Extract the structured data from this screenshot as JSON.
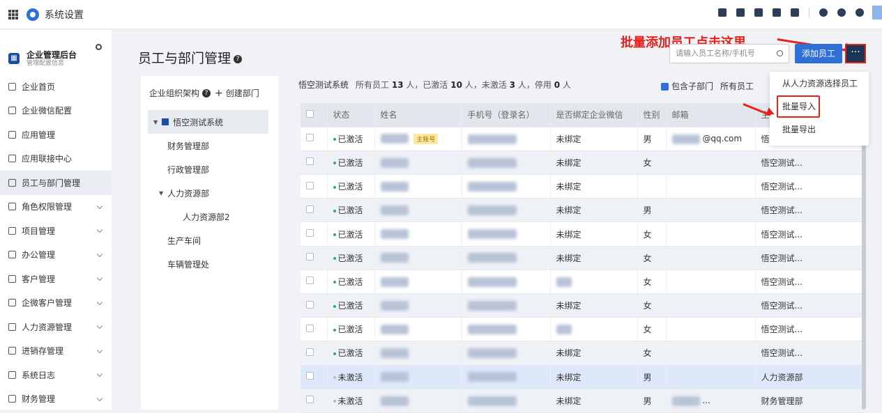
{
  "topbar": {
    "title": "系统设置"
  },
  "sidebar": {
    "header_title": "企业管理后台",
    "header_subtitle": "管理配置信息",
    "items": [
      {
        "label": "企业首页"
      },
      {
        "label": "企业微信配置"
      },
      {
        "label": "应用管理"
      },
      {
        "label": "应用联接中心"
      },
      {
        "label": "员工与部门管理"
      },
      {
        "label": "角色权限管理"
      },
      {
        "label": "项目管理"
      },
      {
        "label": "办公管理"
      },
      {
        "label": "客户管理"
      },
      {
        "label": "企微客户管理"
      },
      {
        "label": "人力资源管理"
      },
      {
        "label": "进销存管理"
      },
      {
        "label": "系统日志"
      },
      {
        "label": "财务管理"
      }
    ]
  },
  "main": {
    "page_title": "员工与部门管理",
    "annotation": "批量添加员工点击这里",
    "search_placeholder": "请输入员工名称/手机号",
    "add_button": "添加员工",
    "more_button": "···",
    "org": {
      "title": "企业组织架构",
      "create": "创建部门",
      "root": "悟空测试系统",
      "depts": [
        "财务管理部",
        "行政管理部",
        "人力资源部",
        "人力资源部2",
        "生产车间",
        "车辆管理处"
      ]
    },
    "list": {
      "company": "悟空测试系统",
      "stats_prefix": "所有员工",
      "total": "13",
      "activated": "10",
      "inactive": "3",
      "disabled": "0",
      "unit": "人",
      "activated_label": "已激活",
      "inactive_label": "未激活",
      "disabled_label": "停用"
    },
    "filter": {
      "include_sub": "包含子部门",
      "all_staff": "所有员工"
    },
    "table": {
      "headers": [
        "状态",
        "姓名",
        "手机号（登录名）",
        "是否绑定企业微信",
        "性别",
        "邮箱",
        "主"
      ],
      "rows": [
        {
          "status": "已激活",
          "wx": "未绑定",
          "gender": "男",
          "email": "@qq.com",
          "dept": "悟"
        },
        {
          "status": "已激活",
          "wx": "未绑定",
          "gender": "女",
          "email": "",
          "dept": "悟空测试..."
        },
        {
          "status": "已激活",
          "wx": "未绑定",
          "gender": "",
          "email": "",
          "dept": "悟空测试..."
        },
        {
          "status": "已激活",
          "wx": "未绑定",
          "gender": "男",
          "email": "",
          "dept": "悟空测试..."
        },
        {
          "status": "已激活",
          "wx": "未绑定",
          "gender": "女",
          "email": "",
          "dept": "悟空测试..."
        },
        {
          "status": "已激活",
          "wx": "未绑定",
          "gender": "女",
          "email": "",
          "dept": "悟空测试..."
        },
        {
          "status": "已激活",
          "wx": "",
          "gender": "女",
          "email": "",
          "dept": "悟空测试..."
        },
        {
          "status": "已激活",
          "wx": "未绑定",
          "gender": "女",
          "email": "",
          "dept": "悟空测试..."
        },
        {
          "status": "已激活",
          "wx": "",
          "gender": "女",
          "email": "",
          "dept": "悟空测试..."
        },
        {
          "status": "已激活",
          "wx": "未绑定",
          "gender": "女",
          "email": "",
          "dept": "悟空测试..."
        },
        {
          "status": "未激活",
          "wx": "未绑定",
          "gender": "男",
          "email": "",
          "dept": "人力资源部"
        },
        {
          "status": "未激活",
          "wx": "未绑定",
          "gender": "男",
          "email": "...",
          "dept": "财务管理部"
        }
      ],
      "main_account_tag": "主账号"
    },
    "dropdown": [
      "从人力资源选择员工",
      "批量导入",
      "批量导出"
    ]
  },
  "colors": {
    "accent": "#2f6fd8",
    "annotation": "#e8201c",
    "active_dot": "#2fae5c"
  }
}
